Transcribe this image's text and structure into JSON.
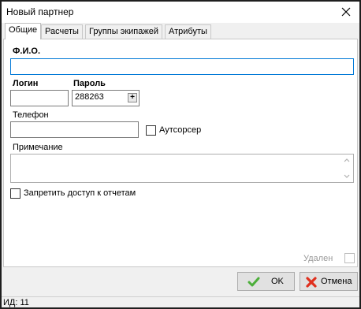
{
  "window": {
    "title": "Новый партнер"
  },
  "tabs": [
    {
      "label": "Общие"
    },
    {
      "label": "Расчеты"
    },
    {
      "label": "Группы экипажей"
    },
    {
      "label": "Атрибуты"
    }
  ],
  "form": {
    "fio_label": "Ф.И.О.",
    "fio_value": "",
    "login_label": "Логин",
    "login_value": "",
    "password_label": "Пароль",
    "password_value": "288263",
    "password_button": "+",
    "phone_label": "Телефон",
    "phone_value": "",
    "outsourcer_label": "Аутсорсер",
    "outsourcer_checked": false,
    "note_label": "Примечание",
    "note_value": "",
    "deny_reports_label": "Запретить доступ к отчетам",
    "deny_reports_checked": false,
    "deleted_label": "Удален",
    "deleted_checked": false
  },
  "buttons": {
    "ok_label": "OK",
    "cancel_label": "Отмена"
  },
  "status": {
    "id_text": "ИД: 11"
  },
  "colors": {
    "focus_border": "#0078d7",
    "ok_icon": "#4caf3a",
    "cancel_icon": "#e0301e"
  },
  "icons": {
    "close": "close-icon",
    "ok": "check-icon",
    "cancel": "x-icon",
    "plus": "plus-icon"
  }
}
